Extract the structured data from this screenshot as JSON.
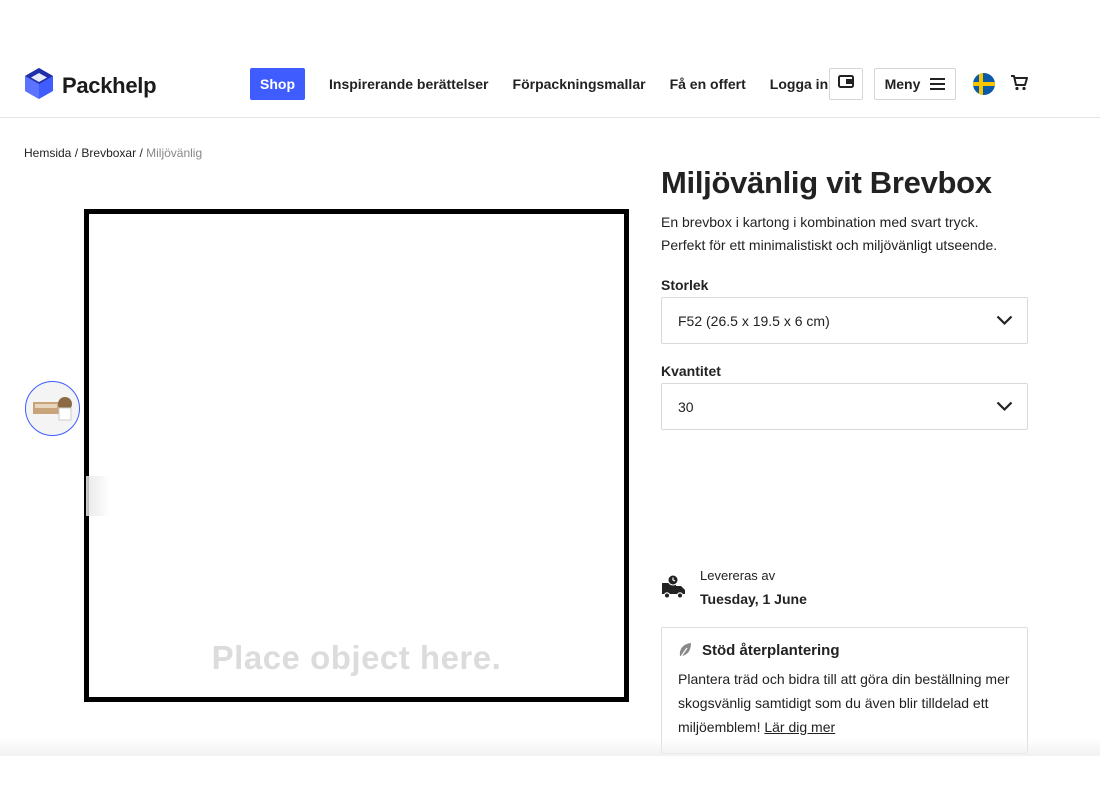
{
  "brand": {
    "name": "Packhelp"
  },
  "nav": {
    "shop": "Shop",
    "links": [
      "Inspirerande berättelser",
      "Förpackningsmallar",
      "Få en offert",
      "Logga in"
    ],
    "menu": "Meny"
  },
  "icons": {
    "logo": "packhelp-cube-icon",
    "wallet": "wallet-icon",
    "menu": "hamburger-icon",
    "flag": "sweden-flag-icon",
    "cart": "cart-icon",
    "delivery": "delivery-truck-icon",
    "leaf": "leaf-icon",
    "chevron": "chevron-down-icon"
  },
  "colors": {
    "accent": "#3f5cff",
    "flag_blue": "#0a5aa8",
    "flag_yellow": "#f7c600"
  },
  "breadcrumb": {
    "home": "Hemsida",
    "category": "Brevboxar",
    "current": "Miljövänlig",
    "separator": "/"
  },
  "viewer": {
    "placeholder": "Place object here."
  },
  "product": {
    "title": "Miljövänlig vit Brevbox",
    "description_line1": "En brevbox i kartong i kombination med svart tryck.",
    "description_line2": "Perfekt för ett minimalistiskt och miljövänligt utseende.",
    "size_label": "Storlek",
    "size_value": "F52 (26.5 x 19.5 x 6 cm)",
    "quantity_label": "Kvantitet",
    "quantity_value": "30"
  },
  "delivery": {
    "label": "Levereras av",
    "date": "Tuesday, 1 June"
  },
  "replant": {
    "title": "Stöd återplantering",
    "text": "Plantera träd och bidra till att göra din beställning mer skogsvänlig samtidigt som du även blir tilldelad ett miljöemblem! ",
    "link": "Lär dig mer"
  }
}
